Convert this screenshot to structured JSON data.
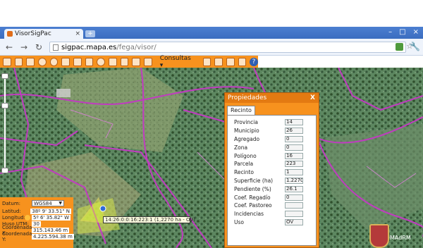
{
  "browser": {
    "tab_title": "VisorSigPac",
    "tab_close": "×",
    "new_tab": "+",
    "window_buttons": [
      "–",
      "□",
      "×"
    ],
    "nav": {
      "back": "←",
      "forward": "→",
      "reload": "↻"
    },
    "url_host": "sigpac.mapa.es",
    "url_path": "/fega/visor/",
    "star": "☆",
    "wrench": "🔧"
  },
  "app_toolbar": {
    "consultas_label": "Consultas ▾",
    "help_label": "?"
  },
  "coordinates": {
    "datum_label": "Datum:",
    "datum_value": "WGS84",
    "rows": [
      {
        "label": "Latitud:",
        "value": "38º 9' 33.51\" N"
      },
      {
        "label": "Longitud:",
        "value": "5º 6' 35.82\" W"
      },
      {
        "label": "Huso UTM:",
        "value": "30"
      },
      {
        "label": "Coordenada X:",
        "value": "315.143.46 m"
      },
      {
        "label": "Coordenada Y:",
        "value": "4.225.594.38 m"
      }
    ]
  },
  "tooltip": "14:26:0:0:16:223:1 (1,2270 ha - OV)",
  "dialog": {
    "title": "Propiedades",
    "close": "X",
    "tab": "Recinto",
    "properties": [
      {
        "label": "Provincia",
        "value": "14"
      },
      {
        "label": "Municipio",
        "value": "26"
      },
      {
        "label": "Agregado",
        "value": "0"
      },
      {
        "label": "Zona",
        "value": "0"
      },
      {
        "label": "Polígono",
        "value": "16"
      },
      {
        "label": "Parcela",
        "value": "223"
      },
      {
        "label": "Recinto",
        "value": "1"
      },
      {
        "label": "Superficie (ha)",
        "value": "1.2270"
      },
      {
        "label": "Pendiente (%)",
        "value": "26.1"
      },
      {
        "label": "Coef. Regadío",
        "value": "0"
      },
      {
        "label": "Coef. Pastoreo",
        "value": ""
      },
      {
        "label": "Incidencias",
        "value": ""
      },
      {
        "label": "Uso",
        "value": "OV"
      }
    ]
  },
  "logo_text": "MAdRM",
  "colors": {
    "accent": "#f7921e",
    "parcel_lines": "#c03cc0"
  }
}
